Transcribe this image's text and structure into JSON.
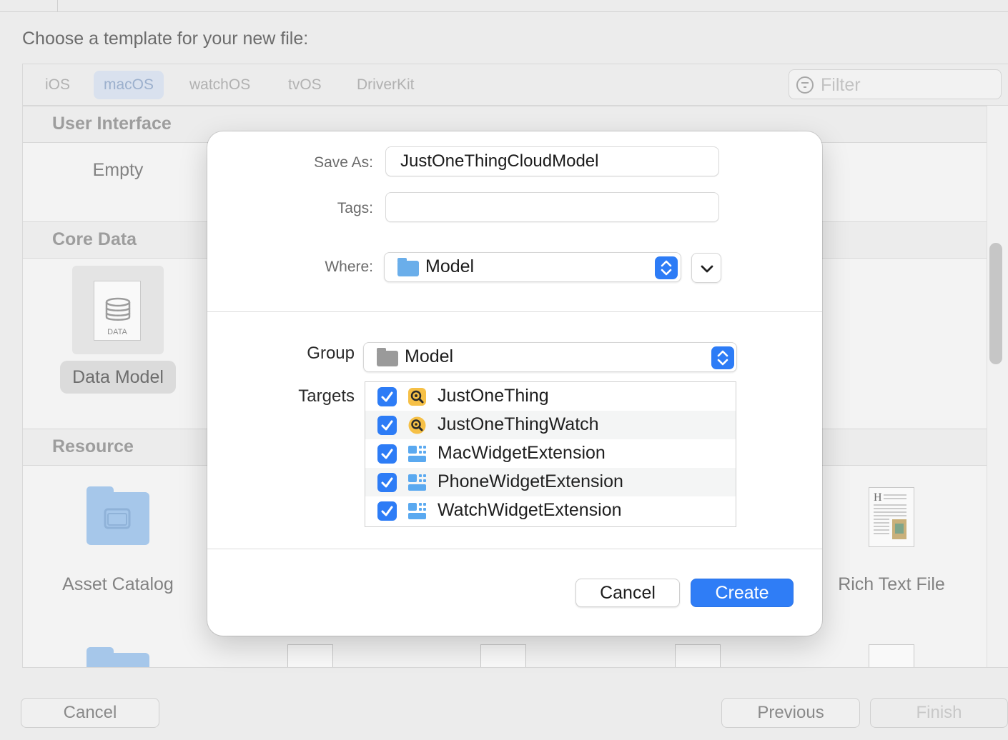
{
  "background": {
    "title": "Choose a template for your new file:",
    "tabs": [
      "iOS",
      "macOS",
      "watchOS",
      "tvOS",
      "DriverKit"
    ],
    "selected_tab": "macOS",
    "filter_placeholder": "Filter",
    "sections": {
      "user_interface": "User Interface",
      "core_data": "Core Data",
      "resource": "Resource"
    },
    "items": {
      "empty": "Empty",
      "data_model": "Data Model",
      "data_icon_label": "DATA",
      "asset_catalog": "Asset Catalog",
      "rich_text_file": "Rich Text File"
    },
    "buttons": {
      "cancel": "Cancel",
      "previous": "Previous",
      "finish": "Finish"
    }
  },
  "dialog": {
    "save_as_label": "Save As:",
    "save_as_value": "JustOneThingCloudModel",
    "tags_label": "Tags:",
    "tags_value": "",
    "where_label": "Where:",
    "where_value": "Model",
    "group_label": "Group",
    "group_value": "Model",
    "targets_label": "Targets",
    "targets": [
      {
        "name": "JustOneThing",
        "checked": true,
        "icon": "app-magnifier-icon"
      },
      {
        "name": "JustOneThingWatch",
        "checked": true,
        "icon": "app-magnifier-icon"
      },
      {
        "name": "MacWidgetExtension",
        "checked": true,
        "icon": "widget-extension-icon"
      },
      {
        "name": "PhoneWidgetExtension",
        "checked": true,
        "icon": "widget-extension-icon"
      },
      {
        "name": "WatchWidgetExtension",
        "checked": true,
        "icon": "widget-extension-icon"
      }
    ],
    "cancel_label": "Cancel",
    "create_label": "Create"
  },
  "colors": {
    "accent": "#2f7df6",
    "app_icon": "#f6c046",
    "widget_icon": "#5aa9f0",
    "folder_blue": "#6aaeea"
  }
}
